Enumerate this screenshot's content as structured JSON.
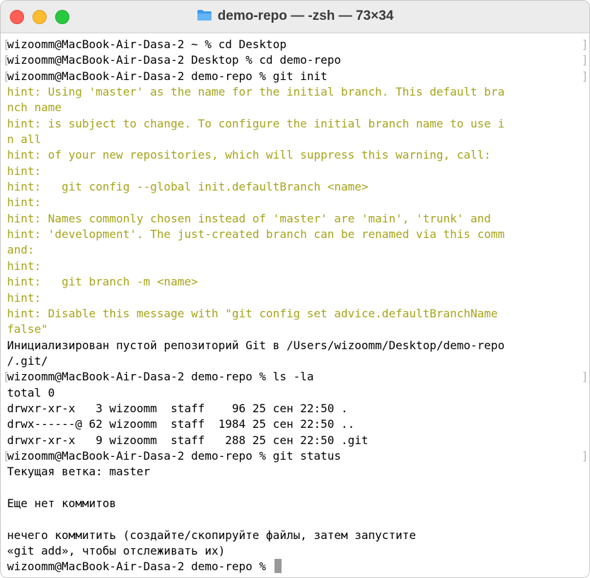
{
  "window": {
    "title": "demo-repo — -zsh — 73×34",
    "folder_icon": "folder-icon",
    "buttons": {
      "close": "close-icon",
      "minimize": "minimize-icon",
      "zoom": "zoom-icon"
    }
  },
  "terminal": {
    "prompt_mark_left": "[",
    "prompt_mark_right": "]",
    "colors": {
      "hint": "#a6a41a",
      "text": "#000000",
      "mark": "#b5b5b5"
    },
    "lines": [
      {
        "text": "wizoomm@MacBook-Air-Dasa-2 ~ % cd Desktop",
        "kind": "prompt"
      },
      {
        "text": "wizoomm@MacBook-Air-Dasa-2 Desktop % cd demo-repo",
        "kind": "prompt"
      },
      {
        "text": "wizoomm@MacBook-Air-Dasa-2 demo-repo % git init",
        "kind": "prompt"
      },
      {
        "text": "hint: Using 'master' as the name for the initial branch. This default bra",
        "kind": "hint"
      },
      {
        "text": "nch name",
        "kind": "hint"
      },
      {
        "text": "hint: is subject to change. To configure the initial branch name to use i",
        "kind": "hint"
      },
      {
        "text": "n all",
        "kind": "hint"
      },
      {
        "text": "hint: of your new repositories, which will suppress this warning, call:",
        "kind": "hint"
      },
      {
        "text": "hint:",
        "kind": "hint"
      },
      {
        "text": "hint:   git config --global init.defaultBranch <name>",
        "kind": "hint"
      },
      {
        "text": "hint:",
        "kind": "hint"
      },
      {
        "text": "hint: Names commonly chosen instead of 'master' are 'main', 'trunk' and",
        "kind": "hint"
      },
      {
        "text": "hint: 'development'. The just-created branch can be renamed via this comm",
        "kind": "hint"
      },
      {
        "text": "and:",
        "kind": "hint"
      },
      {
        "text": "hint:",
        "kind": "hint"
      },
      {
        "text": "hint:   git branch -m <name>",
        "kind": "hint"
      },
      {
        "text": "hint:",
        "kind": "hint"
      },
      {
        "text": "hint: Disable this message with \"git config set advice.defaultBranchName",
        "kind": "hint"
      },
      {
        "text": "false\"",
        "kind": "hint"
      },
      {
        "text": "Инициализирован пустой репозиторий Git в /Users/wizoomm/Desktop/demo-repo",
        "kind": "output"
      },
      {
        "text": "/.git/",
        "kind": "output"
      },
      {
        "text": "wizoomm@MacBook-Air-Dasa-2 demo-repo % ls -la",
        "kind": "prompt"
      },
      {
        "text": "total 0",
        "kind": "output"
      },
      {
        "text": "drwxr-xr-x   3 wizoomm  staff    96 25 сен 22:50 .",
        "kind": "output"
      },
      {
        "text": "drwx------@ 62 wizoomm  staff  1984 25 сен 22:50 ..",
        "kind": "output"
      },
      {
        "text": "drwxr-xr-x   9 wizoomm  staff   288 25 сен 22:50 .git",
        "kind": "output"
      },
      {
        "text": "wizoomm@MacBook-Air-Dasa-2 demo-repo % git status",
        "kind": "prompt"
      },
      {
        "text": "Текущая ветка: master",
        "kind": "output"
      },
      {
        "text": "",
        "kind": "output"
      },
      {
        "text": "Еще нет коммитов",
        "kind": "output"
      },
      {
        "text": "",
        "kind": "output"
      },
      {
        "text": "нечего коммитить (создайте/скопируйте файлы, затем запустите",
        "kind": "output"
      },
      {
        "text": "«git add», чтобы отслеживать их)",
        "kind": "output"
      },
      {
        "text": "wizoomm@MacBook-Air-Dasa-2 demo-repo % ",
        "kind": "current"
      }
    ]
  }
}
